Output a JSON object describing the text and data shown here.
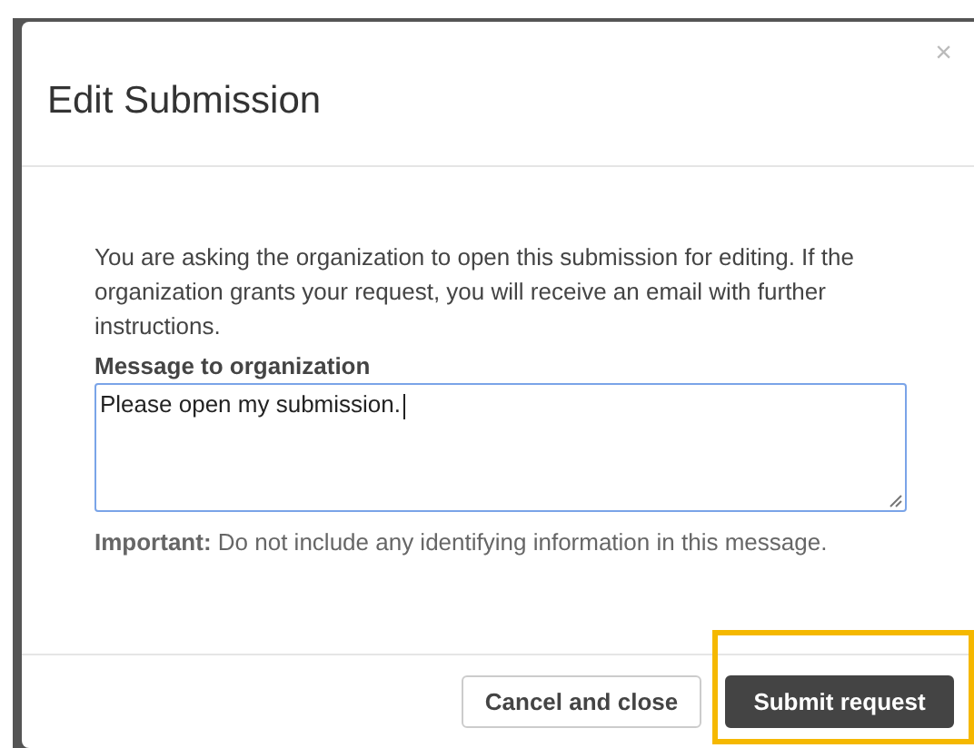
{
  "dialog": {
    "title": "Edit Submission",
    "close": "×",
    "intro": "You are asking the organization to open this submission for editing. If the organization grants your request, you will receive an email with further instructions.",
    "field": {
      "label": "Message to organization",
      "value": "Please open my submission.",
      "focused": true
    },
    "note": "**Important:** Do not include any identifying information in this message.",
    "buttons": [
      {
        "label": "Cancel and close",
        "kind": "secondary",
        "highlighted": false
      },
      {
        "label": "Submit request",
        "kind": "primary",
        "highlighted": true
      }
    ]
  }
}
